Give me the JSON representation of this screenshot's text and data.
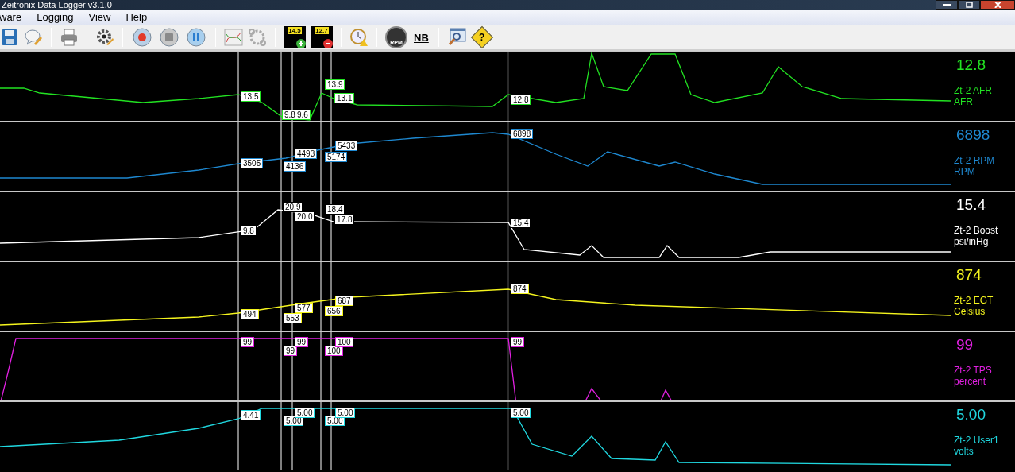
{
  "window": {
    "title": "Zeitronix Data Logger v3.1.0"
  },
  "menu": [
    "ware",
    "Logging",
    "View",
    "Help"
  ],
  "toolbar": [
    {
      "kind": "save"
    },
    {
      "kind": "note"
    },
    {
      "kind": "separator"
    },
    {
      "kind": "print"
    },
    {
      "kind": "separator"
    },
    {
      "kind": "settings"
    },
    {
      "kind": "separator"
    },
    {
      "kind": "record"
    },
    {
      "kind": "stop"
    },
    {
      "kind": "pause"
    },
    {
      "kind": "separator"
    },
    {
      "kind": "graph"
    },
    {
      "kind": "gears"
    },
    {
      "kind": "separator"
    },
    {
      "kind": "add_value",
      "label": "14.5"
    },
    {
      "kind": "remove_value",
      "label": "12.7"
    },
    {
      "kind": "separator"
    },
    {
      "kind": "clock"
    },
    {
      "kind": "separator"
    },
    {
      "kind": "gauge",
      "label": "RPM"
    },
    {
      "kind": "text",
      "label": "NB"
    },
    {
      "kind": "separator"
    },
    {
      "kind": "zoom"
    },
    {
      "kind": "help",
      "label": "?"
    }
  ],
  "channels": [
    {
      "name": "Zt-2 AFR",
      "unit": "AFR",
      "reading": "12.8",
      "color": "#22e222",
      "markers": [
        "13.5",
        "9.8",
        "9.6",
        "13.9",
        "13.1",
        "12.8"
      ]
    },
    {
      "name": "Zt-2 RPM",
      "unit": "RPM",
      "reading": "6898",
      "color": "#1e88d0",
      "markers": [
        "3505",
        "4136",
        "4493",
        "5174",
        "5433",
        "6898"
      ]
    },
    {
      "name": "Zt-2 Boost",
      "unit": "psi/inHg",
      "reading": "15.4",
      "color": "#ffffff",
      "markers": [
        "9.8",
        "20.9",
        "20.0",
        "18.4",
        "17.8",
        "15.4"
      ]
    },
    {
      "name": "Zt-2 EGT",
      "unit": "Celsius",
      "reading": "874",
      "color": "#f5f51e",
      "markers": [
        "494",
        "553",
        "577",
        "656",
        "687",
        "874"
      ]
    },
    {
      "name": "Zt-2 TPS",
      "unit": "percent",
      "reading": "99",
      "color": "#e020e0",
      "markers": [
        "99",
        "99",
        "99",
        "100",
        "100",
        "99"
      ]
    },
    {
      "name": "Zt-2 User1",
      "unit": "volts",
      "reading": "5.00",
      "color": "#20d8e0",
      "markers": [
        "4.41",
        "5.00",
        "5.00",
        "5.00",
        "5.00",
        "5.00"
      ]
    }
  ]
}
